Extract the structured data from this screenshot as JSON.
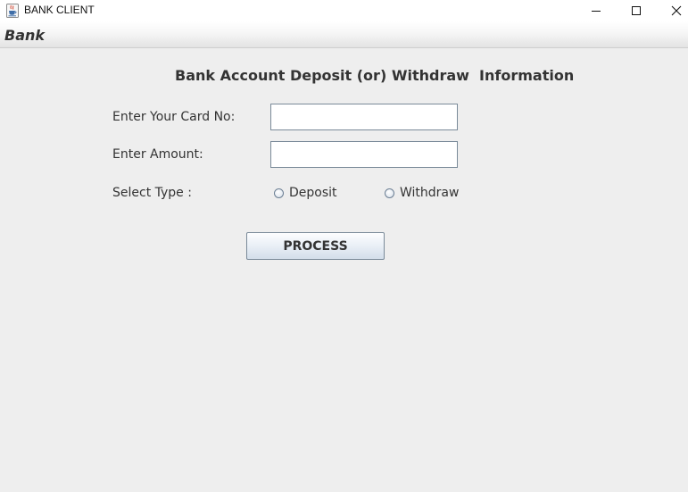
{
  "window": {
    "title": "BANK CLIENT",
    "icon": "java-cup-icon",
    "controls": [
      "minimize-icon",
      "maximize-icon",
      "close-icon"
    ]
  },
  "menubar": {
    "items": [
      {
        "label": "Bank"
      }
    ]
  },
  "form": {
    "heading": "Bank Account Deposit (or) Withdraw  Information",
    "card_label": "Enter Your Card No:",
    "card_value": "",
    "amount_label": "Enter Amount:",
    "amount_value": "",
    "type_label": "Select Type :",
    "type_options": [
      {
        "label": "Deposit",
        "selected": false
      },
      {
        "label": "Withdraw",
        "selected": false
      }
    ],
    "process_label": "PROCESS"
  },
  "colors": {
    "background": "#eeeeee",
    "field_border": "#7a8a99",
    "text": "#333333"
  }
}
